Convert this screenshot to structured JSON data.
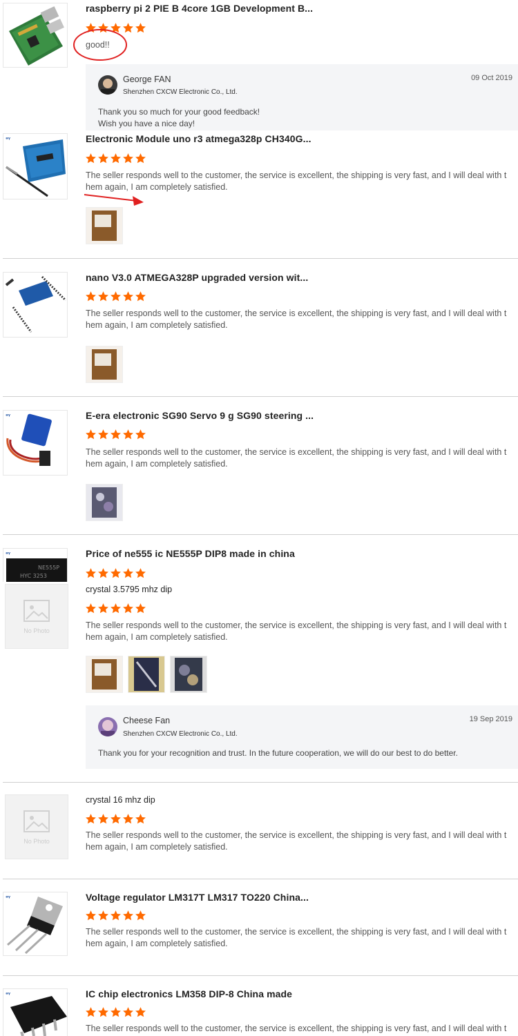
{
  "colors": {
    "star": "#ff6a00",
    "annotation": "#e02020",
    "reply_bg": "#f4f5f7"
  },
  "items": [
    {
      "title": "raspberry pi 2 PIE B 4core 1GB Development B...",
      "rating": 5,
      "review": "good!!",
      "image": "raspberry-pi-board"
    },
    {
      "title": "Electronic Module uno r3 atmega328p CH340G...",
      "rating": 5,
      "review": "The seller responds well to the customer, the service is excellent, the shipping is very fast, and I will deal with them again, I am completely satisfied.",
      "image": "arduino-uno-board"
    },
    {
      "title": "nano V3.0 ATMEGA328P upgraded version wit...",
      "rating": 5,
      "review": "The seller responds well to the customer, the service is excellent, the shipping is very fast, and I will deal with them again, I am completely satisfied.",
      "image": "arduino-nano-board"
    },
    {
      "title": "E-era electronic SG90 Servo 9 g SG90 steering ...",
      "rating": 5,
      "review": "The seller responds well to the customer, the service is excellent, the shipping is very fast, and I will deal with them again, I am completely satisfied.",
      "image": "sg90-servo"
    },
    {
      "title": "Price of ne555 ic NE555P DIP8 made in china",
      "rating": 5,
      "subtitle": "crystal 3.5795 mhz dip",
      "sub_rating": 5,
      "review": "The seller responds well to the customer, the service is excellent, the shipping is very fast, and I will deal with them again, I am completely satisfied.",
      "image": "ne555-chip"
    },
    {
      "subtitle": "crystal 16 mhz dip",
      "rating": 5,
      "review": "The seller responds well to the customer, the service is excellent, the shipping is very fast, and I will deal with them again, I am completely satisfied."
    },
    {
      "title": "Voltage regulator LM317T LM317 TO220 China...",
      "rating": 5,
      "review": "The seller responds well to the customer, the service is excellent, the shipping is very fast, and I will deal with them again, I am completely satisfied.",
      "image": "lm317-regulator"
    },
    {
      "title": "IC chip electronics LM358 DIP-8 China made",
      "rating": 5,
      "review": "The seller responds well to the customer, the service is excellent, the shipping is very fast, and I will deal with them again, I am completely satisfied.",
      "image": "lm358-chip"
    }
  ],
  "replies": [
    {
      "name": "George FAN",
      "company": "Shenzhen CXCW Electronic Co., Ltd.",
      "date": "09 Oct 2019",
      "text1": "Thank you so much for your good feedback!",
      "text2": "Wish you have a nice day!"
    },
    {
      "name": "Cheese Fan",
      "company": "Shenzhen CXCW Electronic Co., Ltd.",
      "date": "19 Sep 2019",
      "text1": "Thank you for your recognition and trust. In the future cooperation, we will do our best to do better."
    }
  ],
  "no_photo_label": "No Photo",
  "review_line1": "The seller responds well to the customer, the service is excellent, the shipping is very fast, and I will deal wit",
  "review_line2": "h them again, I am completely satisfied."
}
